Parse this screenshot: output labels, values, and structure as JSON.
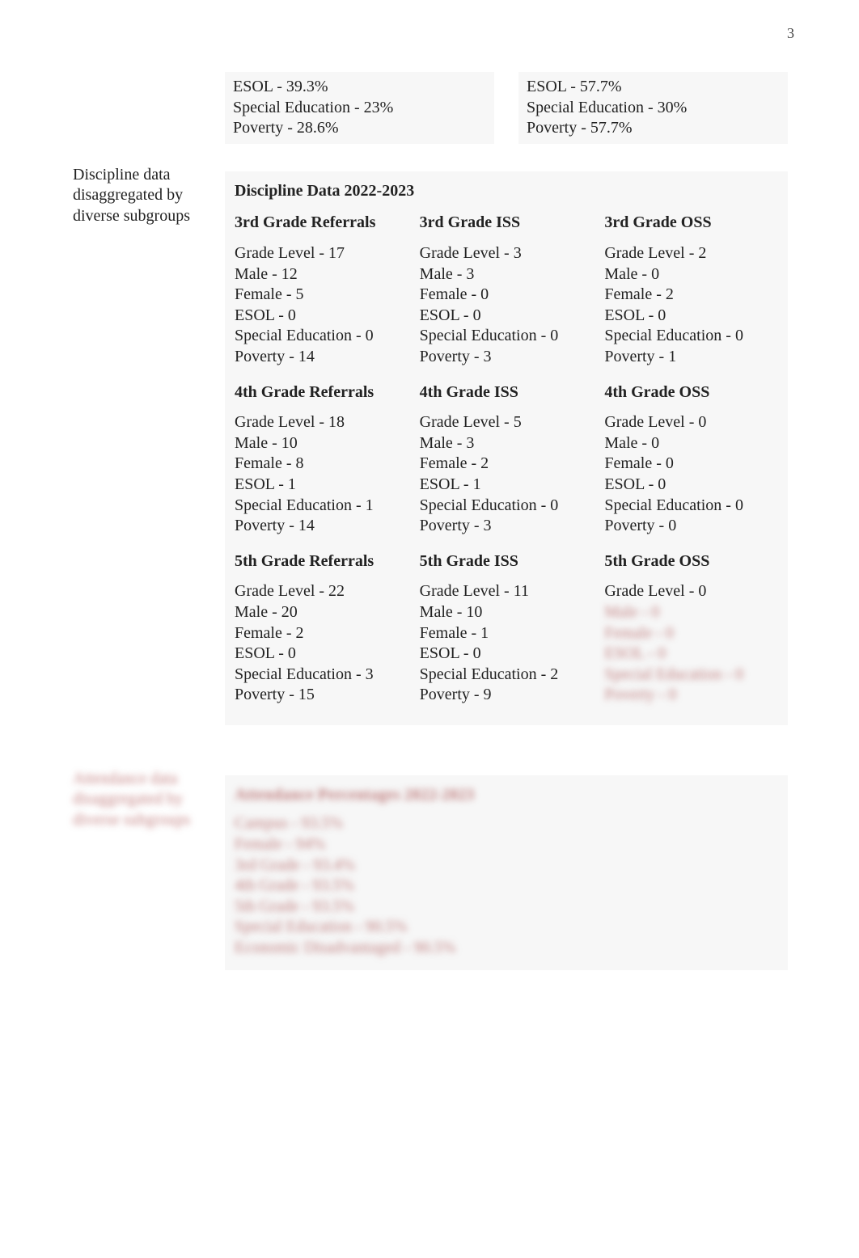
{
  "page_number": "3",
  "top_summary": {
    "left": [
      "ESOL - 39.3%",
      "Special Education - 23%",
      "Poverty - 28.6%"
    ],
    "right": [
      "ESOL - 57.7%",
      "Special Education - 30%",
      "Poverty - 57.7%"
    ]
  },
  "discipline": {
    "row_label": "Discipline data disaggregated by diverse subgroups",
    "title": "Discipline Data 2022-2023",
    "headers": {
      "g3": {
        "ref": "3rd Grade Referrals",
        "iss": "3rd Grade ISS",
        "oss": "3rd Grade OSS"
      },
      "g4": {
        "ref": "4th Grade Referrals",
        "iss": "4th Grade ISS",
        "oss": "4th Grade OSS"
      },
      "g5": {
        "ref": "5th Grade Referrals",
        "iss": "5th Grade ISS",
        "oss": "5th Grade OSS"
      }
    },
    "g3": {
      "ref": [
        "Grade Level - 17",
        "Male - 12",
        "Female - 5",
        "ESOL - 0",
        "Special Education - 0",
        "Poverty - 14"
      ],
      "iss": [
        "Grade Level - 3",
        "Male - 3",
        "Female - 0",
        "ESOL - 0",
        "Special Education - 0",
        "Poverty - 3"
      ],
      "oss": [
        "Grade Level - 2",
        "Male - 0",
        "Female - 2",
        "ESOL - 0",
        "Special Education - 0",
        "Poverty - 1"
      ]
    },
    "g4": {
      "ref": [
        "Grade Level - 18",
        "Male - 10",
        "Female - 8",
        "ESOL - 1",
        "Special Education - 1",
        "Poverty - 14"
      ],
      "iss": [
        "Grade Level - 5",
        "Male - 3",
        "Female - 2",
        "ESOL - 1",
        "Special Education - 0",
        "Poverty - 3"
      ],
      "oss": [
        "Grade Level - 0",
        "Male - 0",
        "Female - 0",
        "ESOL - 0",
        "Special Education - 0",
        "Poverty - 0"
      ]
    },
    "g5": {
      "ref": [
        "Grade Level - 22",
        "Male - 20",
        "Female - 2",
        "ESOL - 0",
        "Special Education - 3",
        "Poverty - 15"
      ],
      "iss": [
        "Grade Level - 11",
        "Male - 10",
        "Female - 1",
        "ESOL - 0",
        "Special Education - 2",
        "Poverty - 9"
      ],
      "oss_first": "Grade Level - 0",
      "oss_obscured": [
        "Male - 0",
        "Female - 0",
        "ESOL - 0",
        "Special Education - 0",
        "Poverty - 0"
      ]
    }
  },
  "attendance": {
    "row_label": "Attendance data disaggregated by diverse subgroups",
    "title": "Attendance Percentages 2022-2023",
    "lines": [
      "Campus - 93.5%",
      "Female - 94%",
      "3rd Grade - 93.4%",
      "4th Grade - 93.5%",
      "5th Grade - 93.5%",
      "Special Education - 90.5%",
      "Economic Disadvantaged - 90.5%"
    ]
  }
}
